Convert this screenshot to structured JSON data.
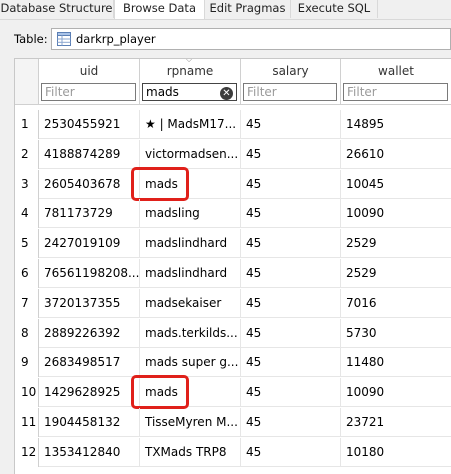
{
  "tabs": [
    "Database Structure",
    "Browse Data",
    "Edit Pragmas",
    "Execute SQL"
  ],
  "active_tab": "Browse Data",
  "table_selector": {
    "label": "Table:",
    "value": "darkrp_player"
  },
  "columns": [
    "uid",
    "rpname",
    "salary",
    "wallet"
  ],
  "filters": [
    {
      "value": "",
      "placeholder": "Filter"
    },
    {
      "value": "mads",
      "placeholder": "Filter"
    },
    {
      "value": "",
      "placeholder": "Filter"
    },
    {
      "value": "",
      "placeholder": "Filter"
    }
  ],
  "rows": [
    {
      "num": "1",
      "uid": "2530455921",
      "rpname": "★ | MadsM17...",
      "salary": "45",
      "wallet": "14895"
    },
    {
      "num": "2",
      "uid": "4188874289",
      "rpname": "victormadsen...",
      "salary": "45",
      "wallet": "26610"
    },
    {
      "num": "3",
      "uid": "2605403678",
      "rpname": "mads",
      "salary": "45",
      "wallet": "10045"
    },
    {
      "num": "4",
      "uid": "781173729",
      "rpname": "madsling",
      "salary": "45",
      "wallet": "10090"
    },
    {
      "num": "5",
      "uid": "2427019109",
      "rpname": "madslindhard",
      "salary": "45",
      "wallet": "2529"
    },
    {
      "num": "6",
      "uid": "76561198208...",
      "rpname": "madslindhard",
      "salary": "45",
      "wallet": "2529"
    },
    {
      "num": "7",
      "uid": "3720137355",
      "rpname": "madsekaiser",
      "salary": "45",
      "wallet": "7016"
    },
    {
      "num": "8",
      "uid": "2889226392",
      "rpname": "mads.terkilds...",
      "salary": "45",
      "wallet": "5730"
    },
    {
      "num": "9",
      "uid": "2683498517",
      "rpname": "mads super g...",
      "salary": "45",
      "wallet": "11480"
    },
    {
      "num": "10",
      "uid": "1429628925",
      "rpname": "mads",
      "salary": "45",
      "wallet": "10090"
    },
    {
      "num": "11",
      "uid": "1904458132",
      "rpname": "TisseMyren M...",
      "salary": "45",
      "wallet": "23721"
    },
    {
      "num": "12",
      "uid": "1353412840",
      "rpname": "TXMads TRP8",
      "salary": "45",
      "wallet": "10180"
    }
  ],
  "highlighted_rows": [
    "3",
    "10"
  ],
  "colors": {
    "highlight": "#e0201a",
    "selected_filter_border": "#444444"
  },
  "icons": {
    "table": "table-icon",
    "clear": "clear-filter-icon",
    "sort": "sort-indicator-icon"
  }
}
